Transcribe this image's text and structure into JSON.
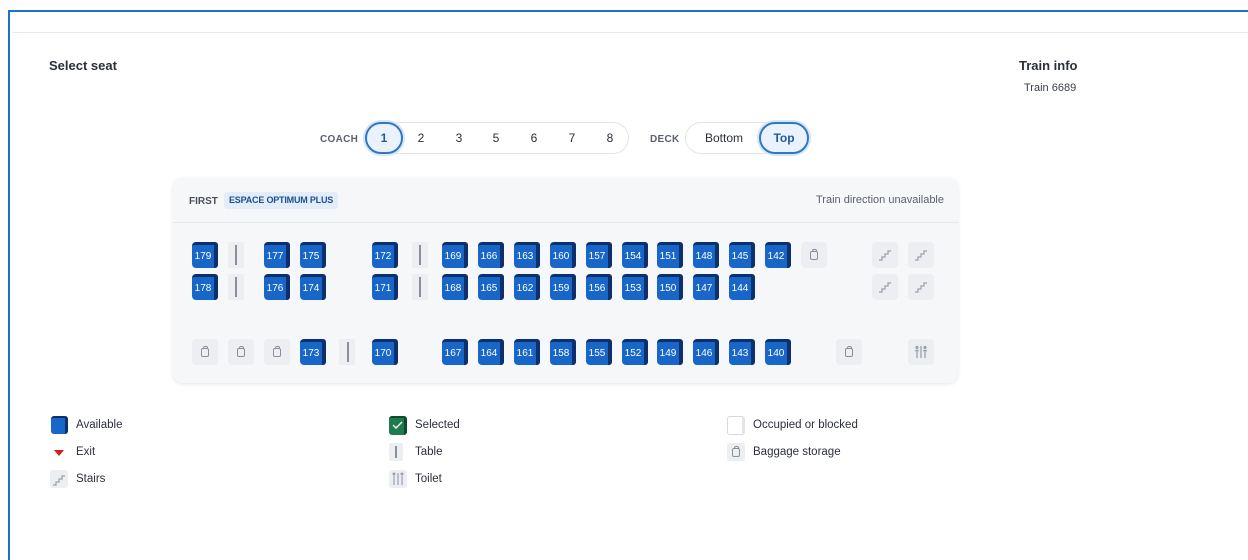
{
  "header": {
    "select_title": "Select seat",
    "train_info_title": "Train info",
    "train_number": "Train 6689"
  },
  "coach_selector": {
    "label": "COACH",
    "options": [
      "1",
      "2",
      "3",
      "5",
      "6",
      "7",
      "8"
    ],
    "selected": "1"
  },
  "deck_selector": {
    "label": "DECK",
    "options": [
      "Bottom",
      "Top"
    ],
    "selected": "Top"
  },
  "panel": {
    "class_label": "FIRST",
    "class_badge": "ESPACE OPTIMUM PLUS",
    "direction": "Train direction unavailable"
  },
  "seat_map": {
    "row1_seats": [
      "179",
      "177",
      "175",
      "172",
      "169",
      "166",
      "163",
      "160",
      "157",
      "154",
      "151",
      "148",
      "145",
      "142"
    ],
    "row2_seats": [
      "178",
      "176",
      "174",
      "171",
      "168",
      "165",
      "162",
      "159",
      "156",
      "153",
      "150",
      "147",
      "144"
    ],
    "row3_seats": [
      "173",
      "170",
      "167",
      "164",
      "161",
      "158",
      "155",
      "152",
      "149",
      "146",
      "143",
      "140"
    ]
  },
  "legend": {
    "available": "Available",
    "selected": "Selected",
    "occupied": "Occupied or blocked",
    "exit": "Exit",
    "table": "Table",
    "baggage": "Baggage storage",
    "stairs": "Stairs",
    "toilet": "Toilet"
  },
  "colors": {
    "seat_fill": "#1766c8",
    "seat_edge": "#0c2f6e",
    "selected": "#1f7a4d",
    "accent": "#2e78c8",
    "exit": "#d61c1c"
  },
  "icons": {
    "baggage": "baggage-icon",
    "stairs": "stairs-icon",
    "toilet": "toilet-icon",
    "exit": "exit-arrow-icon",
    "table": "table-icon"
  }
}
